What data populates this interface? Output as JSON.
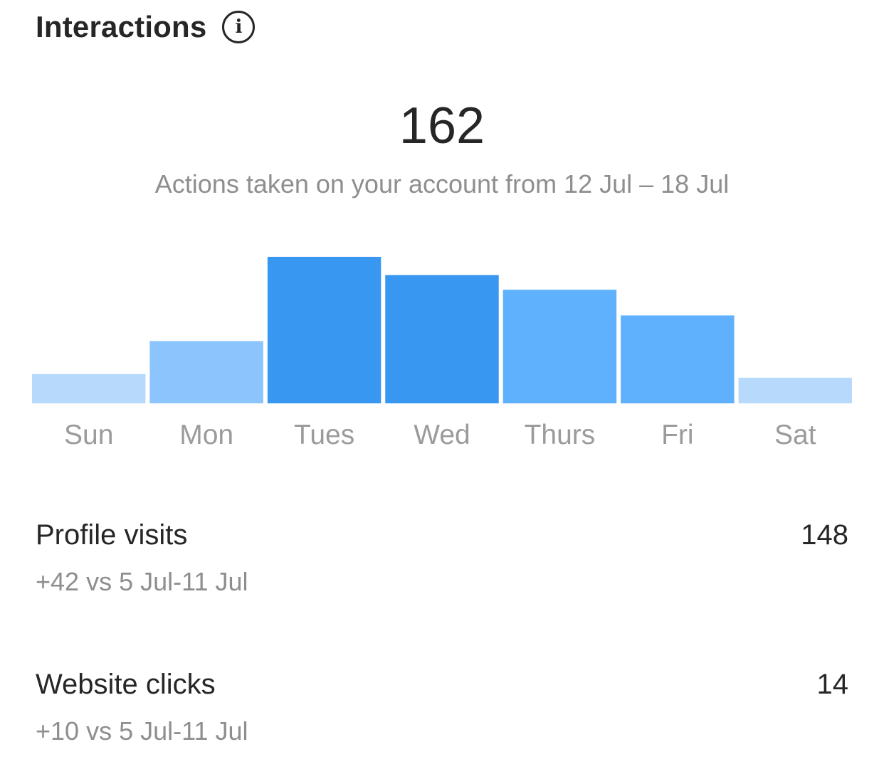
{
  "header": {
    "title": "Interactions",
    "info_icon": "info-circle-icon"
  },
  "summary": {
    "total": "162",
    "subtitle": "Actions taken on your account from 12 Jul – 18 Jul"
  },
  "chart_data": {
    "type": "bar",
    "title": "",
    "xlabel": "",
    "ylabel": "",
    "categories": [
      "Sun",
      "Mon",
      "Tues",
      "Wed",
      "Thurs",
      "Fri",
      "Sat"
    ],
    "values": [
      8,
      17,
      40,
      35,
      31,
      24,
      7
    ],
    "ylim": [
      0,
      40
    ],
    "grid": false,
    "legend": "none",
    "colors": [
      "#B6D9FC",
      "#8CC5FD",
      "#3897F0",
      "#3897F0",
      "#5FB0FD",
      "#5FB0FD",
      "#B6D9FC"
    ]
  },
  "metrics": [
    {
      "label": "Profile visits",
      "value": "148",
      "comparison": "+42 vs 5 Jul-11 Jul"
    },
    {
      "label": "Website clicks",
      "value": "14",
      "comparison": "+10 vs 5 Jul-11 Jul"
    }
  ]
}
